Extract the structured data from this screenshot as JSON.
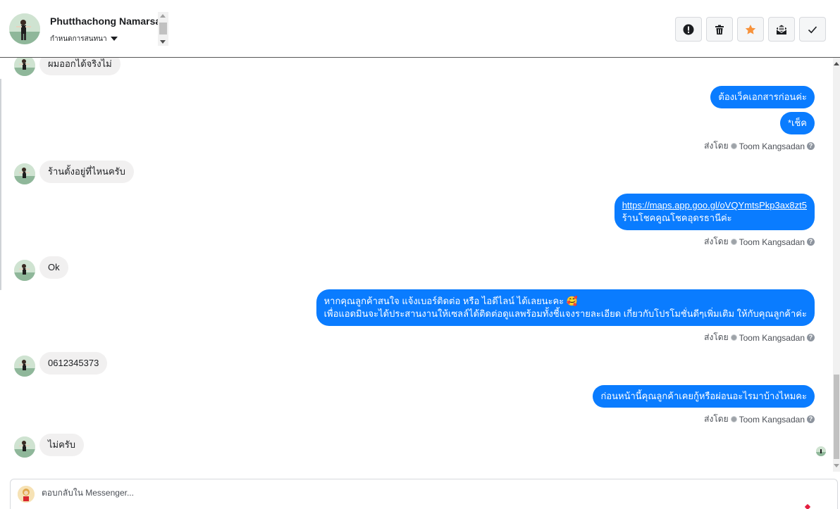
{
  "header": {
    "contact_name": "Phutthachong Namarsa",
    "status_select": "กำหนดการสนทนา",
    "actions": [
      {
        "icon": "alert-icon",
        "label": "Mark as spam"
      },
      {
        "icon": "trash-icon",
        "label": "Delete"
      },
      {
        "icon": "star-icon",
        "label": "Star",
        "color": "#f7923b"
      },
      {
        "icon": "unread-mail-icon",
        "label": "Mark as unread"
      },
      {
        "icon": "check-icon",
        "label": "Mark as done"
      }
    ]
  },
  "messages": [
    {
      "direction": "in",
      "text": "ผมออกได้จริงไม่"
    },
    {
      "direction": "out",
      "text": "ต้องเว็คเอกสารก่อนค่ะ"
    },
    {
      "direction": "out",
      "text": "*เช็ค"
    },
    {
      "direction": "meta",
      "prefix": "ส่งโดย",
      "agent": "Toom Kangsadan"
    },
    {
      "direction": "in",
      "text": "ร้านตั้งอยู่ที่ไหนครับ"
    },
    {
      "direction": "out",
      "link": "https://maps.app.goo.gl/oVQYmtsPkp3ax8zt5",
      "text": "ร้านโชคคูณโชคอุดรธานีค่ะ"
    },
    {
      "direction": "meta",
      "prefix": "ส่งโดย",
      "agent": "Toom Kangsadan"
    },
    {
      "direction": "in",
      "text": "Ok"
    },
    {
      "direction": "out",
      "line1": "หากคุณลูกค้าสนใจ แจ้งเบอร์ติดต่อ หรือ ไอดีไลน์ ได้เลยนะคะ 🥰",
      "line2": "เพื่อแอดมินจะได้ประสานงานให้เซลล์ได้ติดต่อดูแลพร้อมทั้งชี้แจงรายละเอียด เกี่ยวกับโปรโมชั่นดีๆเพิ่มเติม ให้กับคุณลูกค้าค่ะ"
    },
    {
      "direction": "meta",
      "prefix": "ส่งโดย",
      "agent": "Toom Kangsadan"
    },
    {
      "direction": "in",
      "text": "0612345373"
    },
    {
      "direction": "out",
      "text": "ก่อนหน้านี้คุณลูกค้าเคยกู้หรือผ่อนอะไรมาบ้างไหมคะ"
    },
    {
      "direction": "meta",
      "prefix": "ส่งโดย",
      "agent": "Toom Kangsadan"
    },
    {
      "direction": "in",
      "text": "ไม่ครับ"
    }
  ],
  "composer": {
    "placeholder": "ตอบกลับใน Messenger..."
  },
  "colors": {
    "outgoing_bubble": "#0a7cff",
    "incoming_bubble": "#f1f0f0",
    "star": "#f7923b"
  }
}
